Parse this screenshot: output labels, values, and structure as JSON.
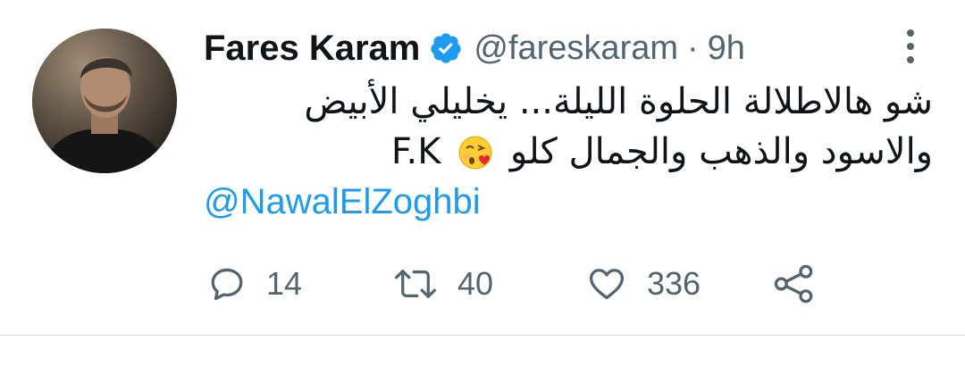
{
  "author": {
    "display_name": "Fares Karam",
    "handle": "@fareskaram",
    "separator": "·",
    "time": "9h",
    "verified": true
  },
  "tweet": {
    "line1": "شو هالاطلالة الحلوة الليلة... يخليلي الأبيض",
    "line2": "والاسود والذهب والجمال كلو",
    "emoji": "kissing-face-with-heart-emoji",
    "signature": "F.K",
    "mention": "@NawalElZoghbi"
  },
  "stats": {
    "replies": "14",
    "retweets": "40",
    "likes": "336"
  },
  "colors": {
    "text": "#0f1419",
    "secondary": "#536471",
    "link": "#1d9bf0",
    "verified": "#1d9bf0"
  }
}
